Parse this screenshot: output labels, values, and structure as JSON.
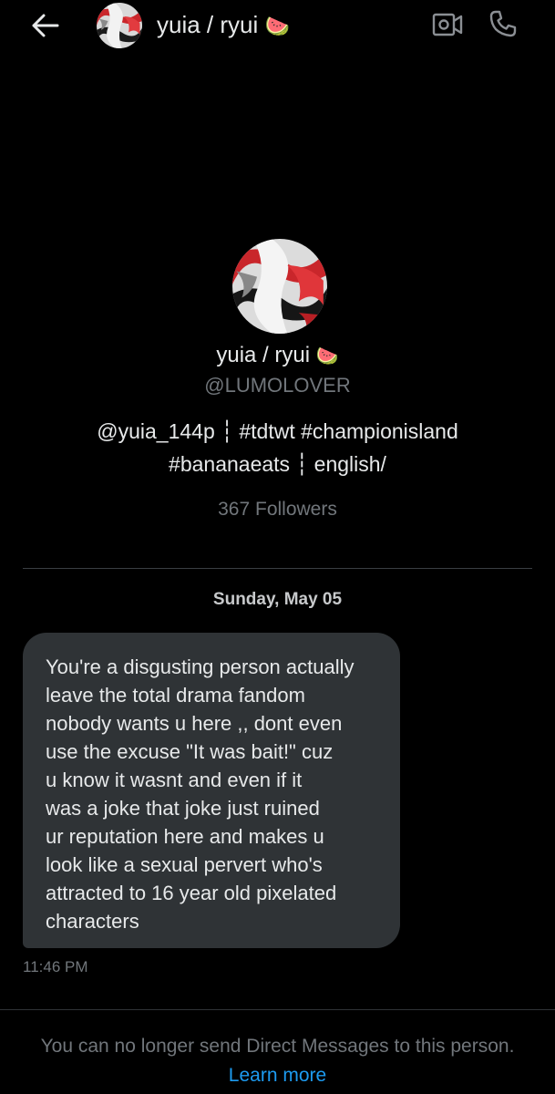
{
  "header": {
    "name": "yuia / ryui",
    "name_emoji": "🍉"
  },
  "profile": {
    "name": "yuia / ryui",
    "name_emoji": "🍉",
    "handle": "@LUMOLOVER",
    "bio_line1": "@yuia_144p ┆ #tdtwt #championisland",
    "bio_line2": "#bananaeats ┆ english/",
    "followers": "367 Followers"
  },
  "conversation": {
    "date": "Sunday, May 05",
    "message": {
      "text": "You're a disgusting person actually\nleave the total drama fandom\nnobody wants u here ,, dont even\nuse the excuse \"It was bait!\" cuz\nu know it wasnt and even if it\nwas a joke that joke just ruined\nur reputation here and makes u\nlook like a sexual pervert who's\nattracted to 16 year old pixelated\ncharacters",
      "time": "11:46 PM"
    }
  },
  "footer": {
    "notice": "You can no longer send Direct Messages to this person.",
    "link": "Learn more"
  },
  "icons": {
    "back": "arrow-left-icon",
    "video": "video-call-icon",
    "phone": "phone-icon"
  },
  "colors": {
    "background": "#000000",
    "bubble": "#2f3336",
    "text": "#e7e9ea",
    "muted": "#71767b",
    "link": "#1d9bf0"
  }
}
